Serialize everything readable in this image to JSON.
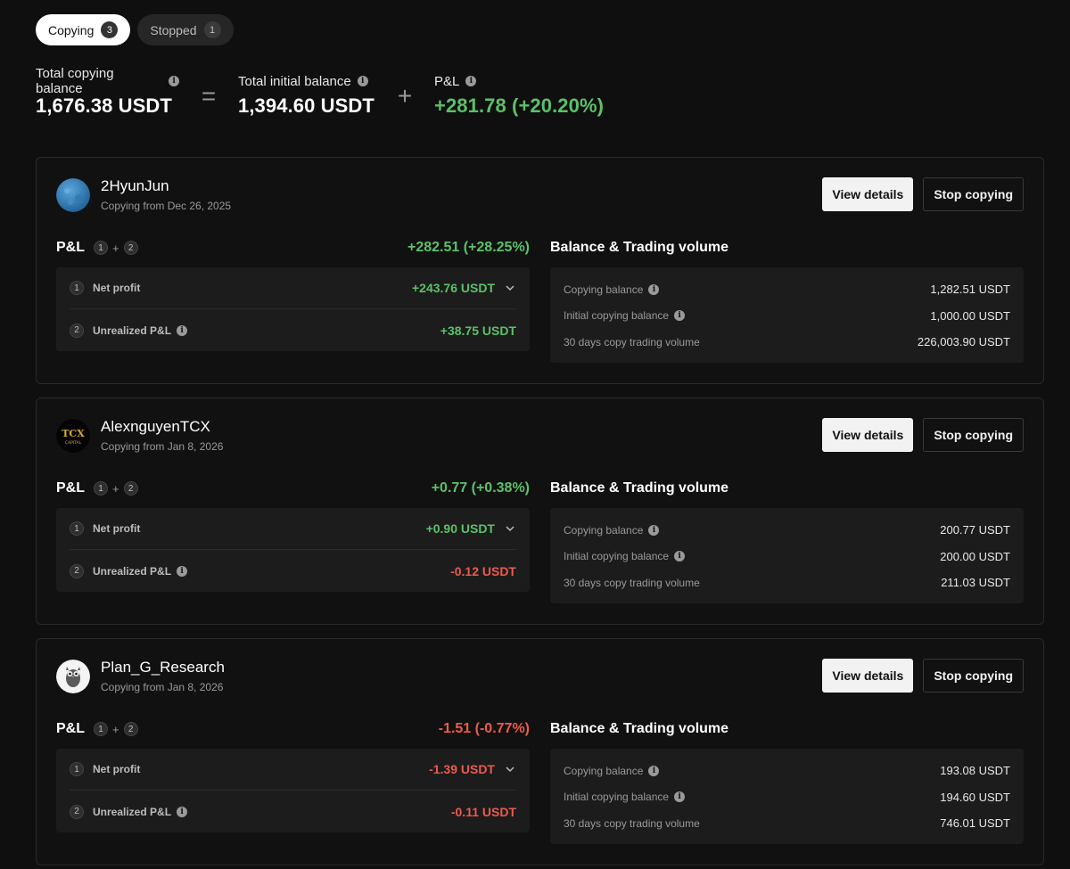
{
  "tabs": [
    {
      "label": "Copying",
      "count": "3"
    },
    {
      "label": "Stopped",
      "count": "1"
    }
  ],
  "summary": {
    "total_copying_label": "Total copying balance",
    "total_copying_value": "1,676.38 USDT",
    "op_equals": "=",
    "total_initial_label": "Total initial balance",
    "total_initial_value": "1,394.60 USDT",
    "op_plus": "+",
    "pnl_label": "P&L",
    "pnl_value": "+281.78 (+20.20%)"
  },
  "common": {
    "view_details": "View details",
    "stop_copying": "Stop copying",
    "pnl_title": "P&L",
    "badge_1": "1",
    "badge_2": "2",
    "plus": "+",
    "net_profit": "Net profit",
    "unrealized": "Unrealized P&L",
    "balance_title": "Balance & Trading volume",
    "copying_balance": "Copying balance",
    "initial_balance": "Initial copying balance",
    "volume_30d": "30 days copy trading volume",
    "info_glyph": "i"
  },
  "traders": [
    {
      "name": "2HyunJun",
      "since": "Copying from Dec 26, 2025",
      "pnl_total": "+282.51 (+28.25%)",
      "net_profit": "+243.76 USDT",
      "unrealized": "+38.75 USDT",
      "copying_balance": "1,282.51 USDT",
      "initial_balance": "1,000.00 USDT",
      "volume_30d": "226,003.90 USDT",
      "avatar_icon": "blue-texture-avatar"
    },
    {
      "name": "AlexnguyenTCX",
      "since": "Copying from Jan 8, 2026",
      "pnl_total": "+0.77 (+0.38%)",
      "net_profit": "+0.90 USDT",
      "unrealized": "-0.12 USDT",
      "copying_balance": "200.77 USDT",
      "initial_balance": "200.00 USDT",
      "volume_30d": "211.03 USDT",
      "avatar_icon": "tcx-capital-logo",
      "avatar_text": "TCX",
      "avatar_subtext": "CAPITAL"
    },
    {
      "name": "Plan_G_Research",
      "since": "Copying from Jan 8, 2026",
      "pnl_total": "-1.51 (-0.77%)",
      "net_profit": "-1.39 USDT",
      "unrealized": "-0.11 USDT",
      "copying_balance": "193.08 USDT",
      "initial_balance": "194.60 USDT",
      "volume_30d": "746.01 USDT",
      "avatar_icon": "owl-avatar"
    }
  ],
  "colors": {
    "positive": "#5cc06a",
    "negative": "#ec5a4e",
    "background": "#0f0f0f",
    "card": "#111111",
    "panel": "#1c1c1c"
  }
}
